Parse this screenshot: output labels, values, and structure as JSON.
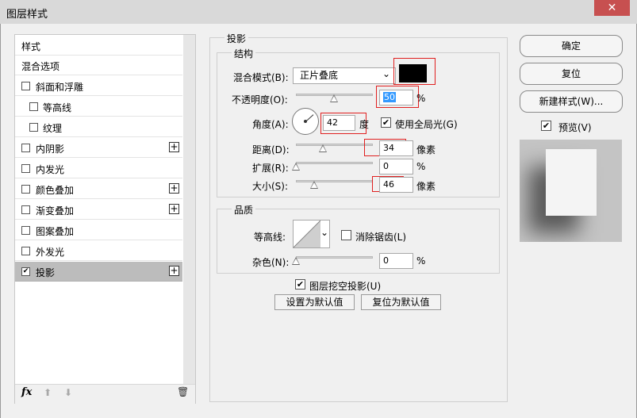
{
  "window": {
    "title": "图层样式",
    "close_glyph": "✕"
  },
  "sidebar": {
    "header": "样式",
    "items": [
      {
        "label": "混合选项",
        "checkbox": false,
        "checked": false,
        "plus": false
      },
      {
        "label": "斜面和浮雕",
        "checkbox": true,
        "checked": false,
        "plus": false
      },
      {
        "label": "等高线",
        "checkbox": true,
        "checked": false,
        "plus": false
      },
      {
        "label": "纹理",
        "checkbox": true,
        "checked": false,
        "plus": false
      },
      {
        "label": "内阴影",
        "checkbox": true,
        "checked": false,
        "plus": true
      },
      {
        "label": "内发光",
        "checkbox": true,
        "checked": false,
        "plus": false
      },
      {
        "label": "颜色叠加",
        "checkbox": true,
        "checked": false,
        "plus": true
      },
      {
        "label": "渐变叠加",
        "checkbox": true,
        "checked": false,
        "plus": true
      },
      {
        "label": "图案叠加",
        "checkbox": true,
        "checked": false,
        "plus": false
      },
      {
        "label": "外发光",
        "checkbox": true,
        "checked": false,
        "plus": false
      },
      {
        "label": "投影",
        "checkbox": true,
        "checked": true,
        "plus": true,
        "selected": true
      }
    ],
    "footer": {
      "fx_label": "fx",
      "up_glyph": "⬆",
      "down_glyph": "⬇",
      "trash_glyph": "🗑"
    }
  },
  "shadow": {
    "section_title": "投影",
    "structure_title": "结构",
    "blend_mode_label": "混合模式(B):",
    "blend_mode_value": "正片叠底",
    "blend_color": "#000000",
    "opacity_label": "不透明度(O):",
    "opacity_value": "50",
    "opacity_unit": "%",
    "opacity_fraction": 0.5,
    "angle_label": "角度(A):",
    "angle_value": "42",
    "angle_unit": "度",
    "global_light_label": "使用全局光(G)",
    "global_light_checked": true,
    "distance_label": "距离(D):",
    "distance_value": "34",
    "distance_unit": "像素",
    "spread_label": "扩展(R):",
    "spread_value": "0",
    "spread_unit": "%",
    "size_label": "大小(S):",
    "size_value": "46",
    "size_unit": "像素",
    "quality_title": "品质",
    "contour_label": "等高线:",
    "antialias_label": "消除锯齿(L)",
    "antialias_checked": false,
    "noise_label": "杂色(N):",
    "noise_value": "0",
    "noise_unit": "%",
    "knockout_label": "图层挖空投影(U)",
    "knockout_checked": true,
    "set_default_label": "设置为默认值",
    "reset_default_label": "复位为默认值"
  },
  "actions": {
    "ok_label": "确定",
    "reset_label": "复位",
    "new_style_label": "新建样式(W)...",
    "preview_label": "预览(V)",
    "preview_checked": true
  },
  "colors": {
    "accent_red": "#e02020",
    "selection": "#bcbcbc"
  },
  "check_glyph": "✔",
  "plus_glyph": "+",
  "chevron_glyph": "⌄"
}
